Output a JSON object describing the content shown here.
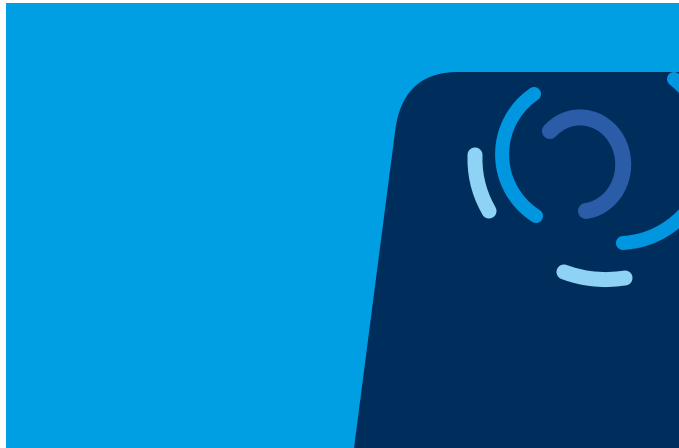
{
  "colors": {
    "background": "#ffffff",
    "field": "#009EE3",
    "panel": "#002E5C",
    "arc_light": "#8ED3F6",
    "arc_bright": "#0096E0",
    "arc_mid": "#2B5CA8"
  },
  "graphic": {
    "name": "abstract-brand-graphic",
    "icon": "concentric-arcs-logo-icon"
  }
}
